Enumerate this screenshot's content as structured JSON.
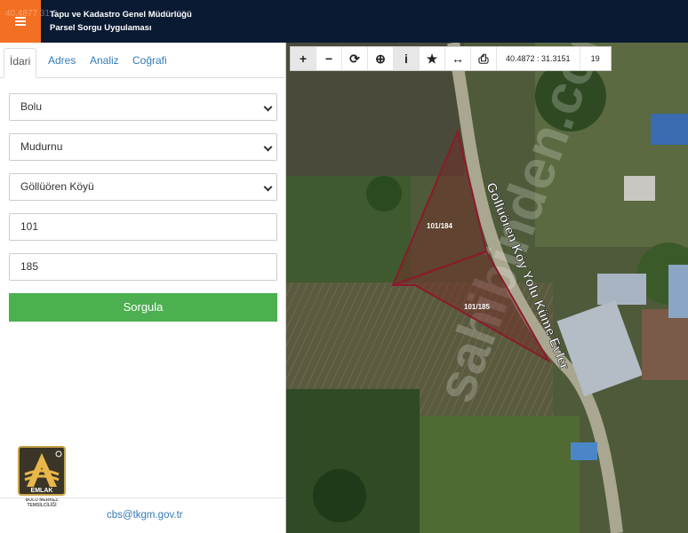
{
  "header": {
    "title_line1": "Tapu ve Kadastro Genel Müdürlüğü",
    "title_line2": "Parsel Sorgu Uygulaması",
    "ghost_coord": "40.4877 31.3"
  },
  "tabs": [
    {
      "label": "İdari",
      "active": true
    },
    {
      "label": "Adres",
      "active": false
    },
    {
      "label": "Analiz",
      "active": false
    },
    {
      "label": "Coğrafi",
      "active": false
    }
  ],
  "form": {
    "il": "Bolu",
    "ilce": "Mudurnu",
    "mahalle": "Göllüören Köyü",
    "ada": "101",
    "parsel": "185",
    "submit_label": "Sorgula"
  },
  "logo": {
    "brand": "EMLAK",
    "line1": "BOLU MERKEZ",
    "line2": "TEMSİLCİLİĞİ"
  },
  "footer": {
    "email": "cbs@tkgm.gov.tr"
  },
  "map": {
    "coordinates": "40.4872 : 31.3151",
    "zoom": "19",
    "road_label": "Göllüören Köy Yolu Küme Evler",
    "parcels": [
      {
        "label": "101/184"
      },
      {
        "label": "101/185"
      }
    ],
    "watermark": "sahibinden.com",
    "parcel_outline_color": "#8b1a2b"
  },
  "toolbar": {
    "icons": [
      "zoom-in-icon",
      "zoom-out-icon",
      "refresh-icon",
      "locate-icon",
      "info-icon",
      "star-icon",
      "measure-icon",
      "print-icon"
    ]
  }
}
